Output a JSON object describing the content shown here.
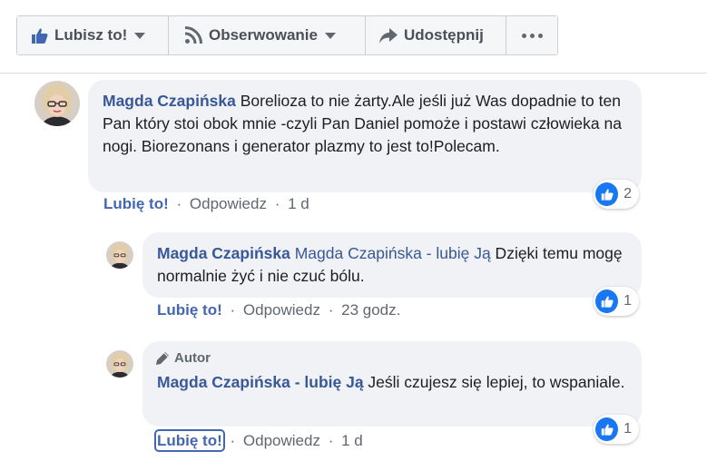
{
  "toolbar": {
    "like_label": "Lubisz to!",
    "like_icon": "thumbs-up-icon",
    "follow_label": "Obserwowanie",
    "follow_icon": "rss-icon",
    "share_label": "Udostępnij",
    "share_icon": "share-arrow-icon",
    "more_icon": "more-dots-icon"
  },
  "actions": {
    "like": "Lubię to!",
    "reply": "Odpowiedz",
    "separator": "·"
  },
  "comments": [
    {
      "author": "Magda Czapińska",
      "text": " Borelioza to nie żarty.Ale jeśli już Was dopadnie to ten Pan który stoi obok mnie -czyli Pan Daniel pomoże i postawi człowieka na nogi. Biorezonans i generator plazmy to jest to!Polecam.",
      "time": "1 d",
      "reactions": "2"
    },
    {
      "author": "Magda Czapińska",
      "mention": "Magda Czapińska - lubię Ją",
      "text": " Dzięki temu mogę normalnie żyć i nie czuć bólu.",
      "time": "23 godz.",
      "reactions": "1"
    },
    {
      "badge": "Autor",
      "author": "Magda Czapińska - lubię Ją",
      "text": " Jeśli czujesz się lepiej, to wspaniale.",
      "time": "1 d",
      "reactions": "1"
    }
  ],
  "colors": {
    "link": "#385898",
    "action": "#4267b2",
    "bubble": "#f0f2f5",
    "like_blue": "#1877f2"
  }
}
